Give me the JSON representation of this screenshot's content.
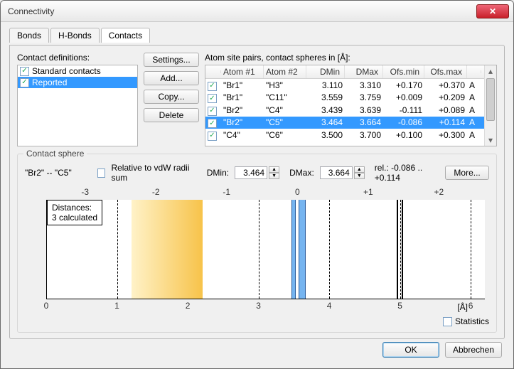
{
  "window": {
    "title": "Connectivity"
  },
  "tabs": {
    "items": [
      "Bonds",
      "H-Bonds",
      "Contacts"
    ],
    "active": 2
  },
  "defs": {
    "label": "Contact definitions:",
    "items": [
      {
        "name": "Standard contacts",
        "checked": true,
        "selected": false
      },
      {
        "name": "Reported",
        "checked": true,
        "selected": true
      }
    ]
  },
  "def_buttons": {
    "settings": "Settings...",
    "add": "Add...",
    "copy": "Copy...",
    "del": "Delete"
  },
  "pairs": {
    "label": "Atom site pairs, contact spheres in [Å]:",
    "columns": [
      "",
      "Atom #1",
      "Atom #2",
      "DMin",
      "DMax",
      "Ofs.min",
      "Ofs.max",
      ""
    ],
    "rows": [
      {
        "checked": true,
        "a1": "\"Br1\"",
        "a2": "\"H3\"",
        "dmin": "3.110",
        "dmax": "3.310",
        "omin": "+0.170",
        "omax": "+0.370",
        "flag": "A",
        "selected": false
      },
      {
        "checked": true,
        "a1": "\"Br1\"",
        "a2": "\"C11\"",
        "dmin": "3.559",
        "dmax": "3.759",
        "omin": "+0.009",
        "omax": "+0.209",
        "flag": "A",
        "selected": false
      },
      {
        "checked": true,
        "a1": "\"Br2\"",
        "a2": "\"C4\"",
        "dmin": "3.439",
        "dmax": "3.639",
        "omin": "-0.111",
        "omax": "+0.089",
        "flag": "A",
        "selected": false
      },
      {
        "checked": true,
        "a1": "\"Br2\"",
        "a2": "\"C5\"",
        "dmin": "3.464",
        "dmax": "3.664",
        "omin": "-0.086",
        "omax": "+0.114",
        "flag": "A",
        "selected": true
      },
      {
        "checked": true,
        "a1": "\"C4\"",
        "a2": "\"C6\"",
        "dmin": "3.500",
        "dmax": "3.700",
        "omin": "+0.100",
        "omax": "+0.300",
        "flag": "A",
        "selected": false
      }
    ]
  },
  "sphere": {
    "legend": "Contact sphere",
    "pair": "\"Br2\" -- \"C5\"",
    "relative_label": "Relative to vdW radii sum",
    "relative_checked": false,
    "dmin_label": "DMin:",
    "dmin": "3.464",
    "dmax_label": "DMax:",
    "dmax": "3.664",
    "rel_label": "rel.: -0.086 .. +0.114",
    "more": "More...",
    "distances_label": "Distances:\n3 calculated",
    "stats_label": "Statistics",
    "stats_checked": false
  },
  "chart_data": {
    "type": "other",
    "bottom_axis": {
      "label": "[Å]",
      "ticks": [
        0,
        1,
        2,
        3,
        4,
        5,
        6
      ],
      "range": [
        0,
        6.2
      ]
    },
    "top_axis": {
      "ticks": [
        -3,
        -2,
        -1,
        0,
        1,
        2
      ],
      "zero_at_bottom_x": 3.55
    },
    "yellow_band_x": [
      1.2,
      2.2
    ],
    "blue_bands_x": [
      [
        3.464,
        3.52
      ],
      [
        3.56,
        3.664
      ]
    ],
    "vlines_x": [
      4.95,
      5.02
    ],
    "gridlines_x": [
      1,
      2,
      3,
      4,
      5,
      6
    ]
  },
  "footer": {
    "ok": "OK",
    "cancel": "Abbrechen"
  }
}
